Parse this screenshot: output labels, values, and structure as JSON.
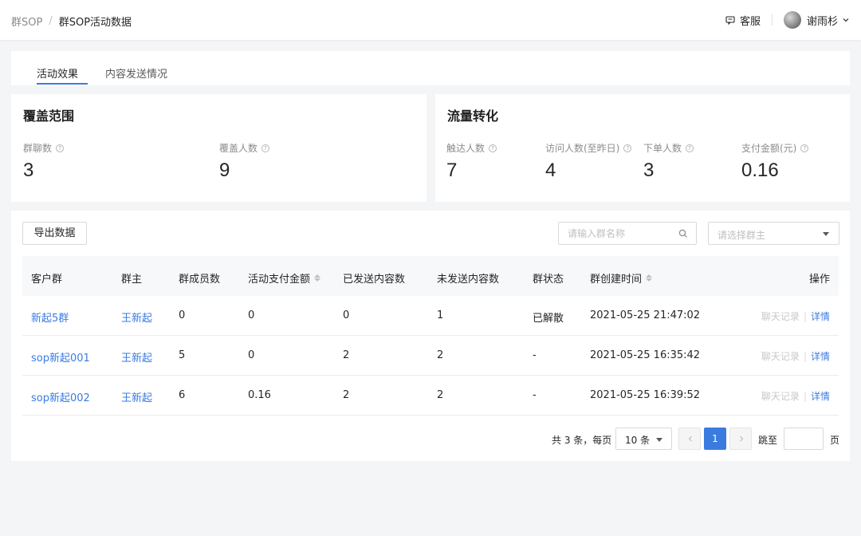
{
  "breadcrumb": {
    "parent": "群SOP",
    "separator": "/",
    "current": "群SOP活动数据"
  },
  "header": {
    "service_label": "客服",
    "user_name": "谢雨杉"
  },
  "tabs": [
    {
      "label": "活动效果",
      "active": true
    },
    {
      "label": "内容发送情况",
      "active": false
    }
  ],
  "coverage": {
    "title": "覆盖范围",
    "stats": [
      {
        "label": "群聊数",
        "value": "3"
      },
      {
        "label": "覆盖人数",
        "value": "9"
      }
    ]
  },
  "conversion": {
    "title": "流量转化",
    "stats": [
      {
        "label": "触达人数",
        "value": "7"
      },
      {
        "label": "访问人数(至昨日)",
        "value": "4"
      },
      {
        "label": "下单人数",
        "value": "3"
      },
      {
        "label": "支付金额(元)",
        "value": "0.16"
      }
    ]
  },
  "toolbar": {
    "export_label": "导出数据",
    "search_placeholder": "请输入群名称",
    "owner_select_placeholder": "请选择群主"
  },
  "table": {
    "columns": [
      "客户群",
      "群主",
      "群成员数",
      "活动支付金额",
      "已发送内容数",
      "未发送内容数",
      "群状态",
      "群创建时间",
      "操作"
    ],
    "rows": [
      {
        "group": "新起5群",
        "owner": "王新起",
        "members": "0",
        "amount": "0",
        "sent": "0",
        "unsent": "1",
        "status": "已解散",
        "created": "2021-05-25 21:47:02"
      },
      {
        "group": "sop新起001",
        "owner": "王新起",
        "members": "5",
        "amount": "0",
        "sent": "2",
        "unsent": "2",
        "status": "-",
        "created": "2021-05-25 16:35:42"
      },
      {
        "group": "sop新起002",
        "owner": "王新起",
        "members": "6",
        "amount": "0.16",
        "sent": "2",
        "unsent": "2",
        "status": "-",
        "created": "2021-05-25 16:39:52"
      }
    ],
    "action_chat": "聊天记录",
    "action_divider": "|",
    "action_detail": "详情"
  },
  "pagination": {
    "total_text": "共 3 条，每页",
    "page_size": "10 条",
    "current_page": "1",
    "jump_label": "跳至",
    "page_unit": "页"
  },
  "colors": {
    "accent": "#3b7be0",
    "background": "#f4f5f7"
  }
}
